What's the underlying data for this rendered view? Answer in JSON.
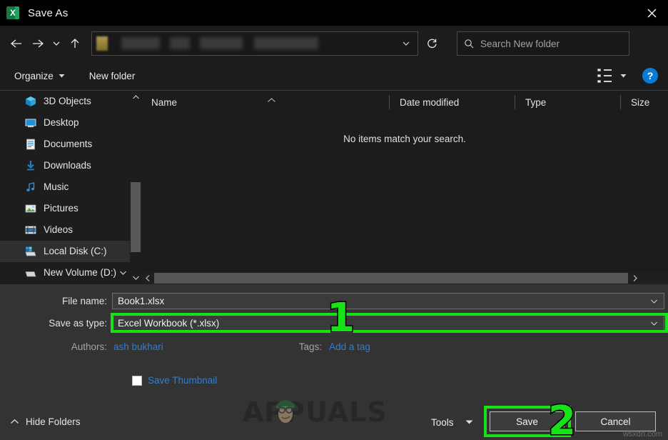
{
  "window": {
    "title": "Save As",
    "app_icon": "excel-icon",
    "app_icon_letter": "X",
    "close_icon": "close-icon"
  },
  "nav": {
    "back_icon": "back-arrow-icon",
    "forward_icon": "forward-arrow-icon",
    "recent_icon": "recent-locations-chevron-icon",
    "up_icon": "up-arrow-icon",
    "address_value": "",
    "address_redacted": true,
    "address_dropdown_icon": "chevron-down-icon",
    "refresh_icon": "refresh-icon"
  },
  "search": {
    "icon": "search-icon",
    "placeholder": "Search New folder",
    "value": ""
  },
  "toolbar": {
    "organize_label": "Organize",
    "new_folder_label": "New folder",
    "view_icon": "view-layout-icon",
    "view_caret_icon": "chevron-down-icon",
    "help_label": "?"
  },
  "sidebar": {
    "items": [
      {
        "label": "3D Objects",
        "icon": "3d-objects-icon",
        "selected": false
      },
      {
        "label": "Desktop",
        "icon": "desktop-icon",
        "selected": false
      },
      {
        "label": "Documents",
        "icon": "documents-icon",
        "selected": false
      },
      {
        "label": "Downloads",
        "icon": "downloads-icon",
        "selected": false
      },
      {
        "label": "Music",
        "icon": "music-icon",
        "selected": false
      },
      {
        "label": "Pictures",
        "icon": "pictures-icon",
        "selected": false
      },
      {
        "label": "Videos",
        "icon": "videos-icon",
        "selected": false
      },
      {
        "label": "Local Disk (C:)",
        "icon": "local-disk-icon",
        "selected": true
      },
      {
        "label": "New Volume (D:)",
        "icon": "drive-icon",
        "selected": false
      }
    ],
    "scroll_up_icon": "chevron-up-icon",
    "scroll_down_icon": "chevron-down-icon"
  },
  "filelist": {
    "columns": [
      "Name",
      "Date modified",
      "Type",
      "Size"
    ],
    "sort_column": "Name",
    "sort_caret": "▲",
    "rows": [],
    "empty_message": "No items match your search.",
    "scroll_left_icon": "chevron-left-icon",
    "scroll_right_icon": "chevron-right-icon"
  },
  "form": {
    "file_name_label": "File name:",
    "file_name_value": "Book1.xlsx",
    "save_as_type_label": "Save as type:",
    "save_as_type_value": "Excel Workbook (*.xlsx)",
    "combo_caret_icon": "chevron-down-icon",
    "authors_label": "Authors:",
    "authors_value": "ash bukhari",
    "tags_label": "Tags:",
    "tags_value": "Add a tag",
    "save_thumbnail_label": "Save Thumbnail",
    "save_thumbnail_checked": false
  },
  "footer": {
    "hide_folders_label": "Hide Folders",
    "hide_folders_icon": "chevron-up-icon",
    "tools_label": "Tools",
    "tools_caret_icon": "chevron-down-icon",
    "save_label": "Save",
    "cancel_label": "Cancel"
  },
  "annotations": {
    "color": "#17e217",
    "step_one": "1",
    "step_two": "2"
  },
  "watermarks": {
    "brand": "APPUALS",
    "site": "wsxdn.com"
  }
}
